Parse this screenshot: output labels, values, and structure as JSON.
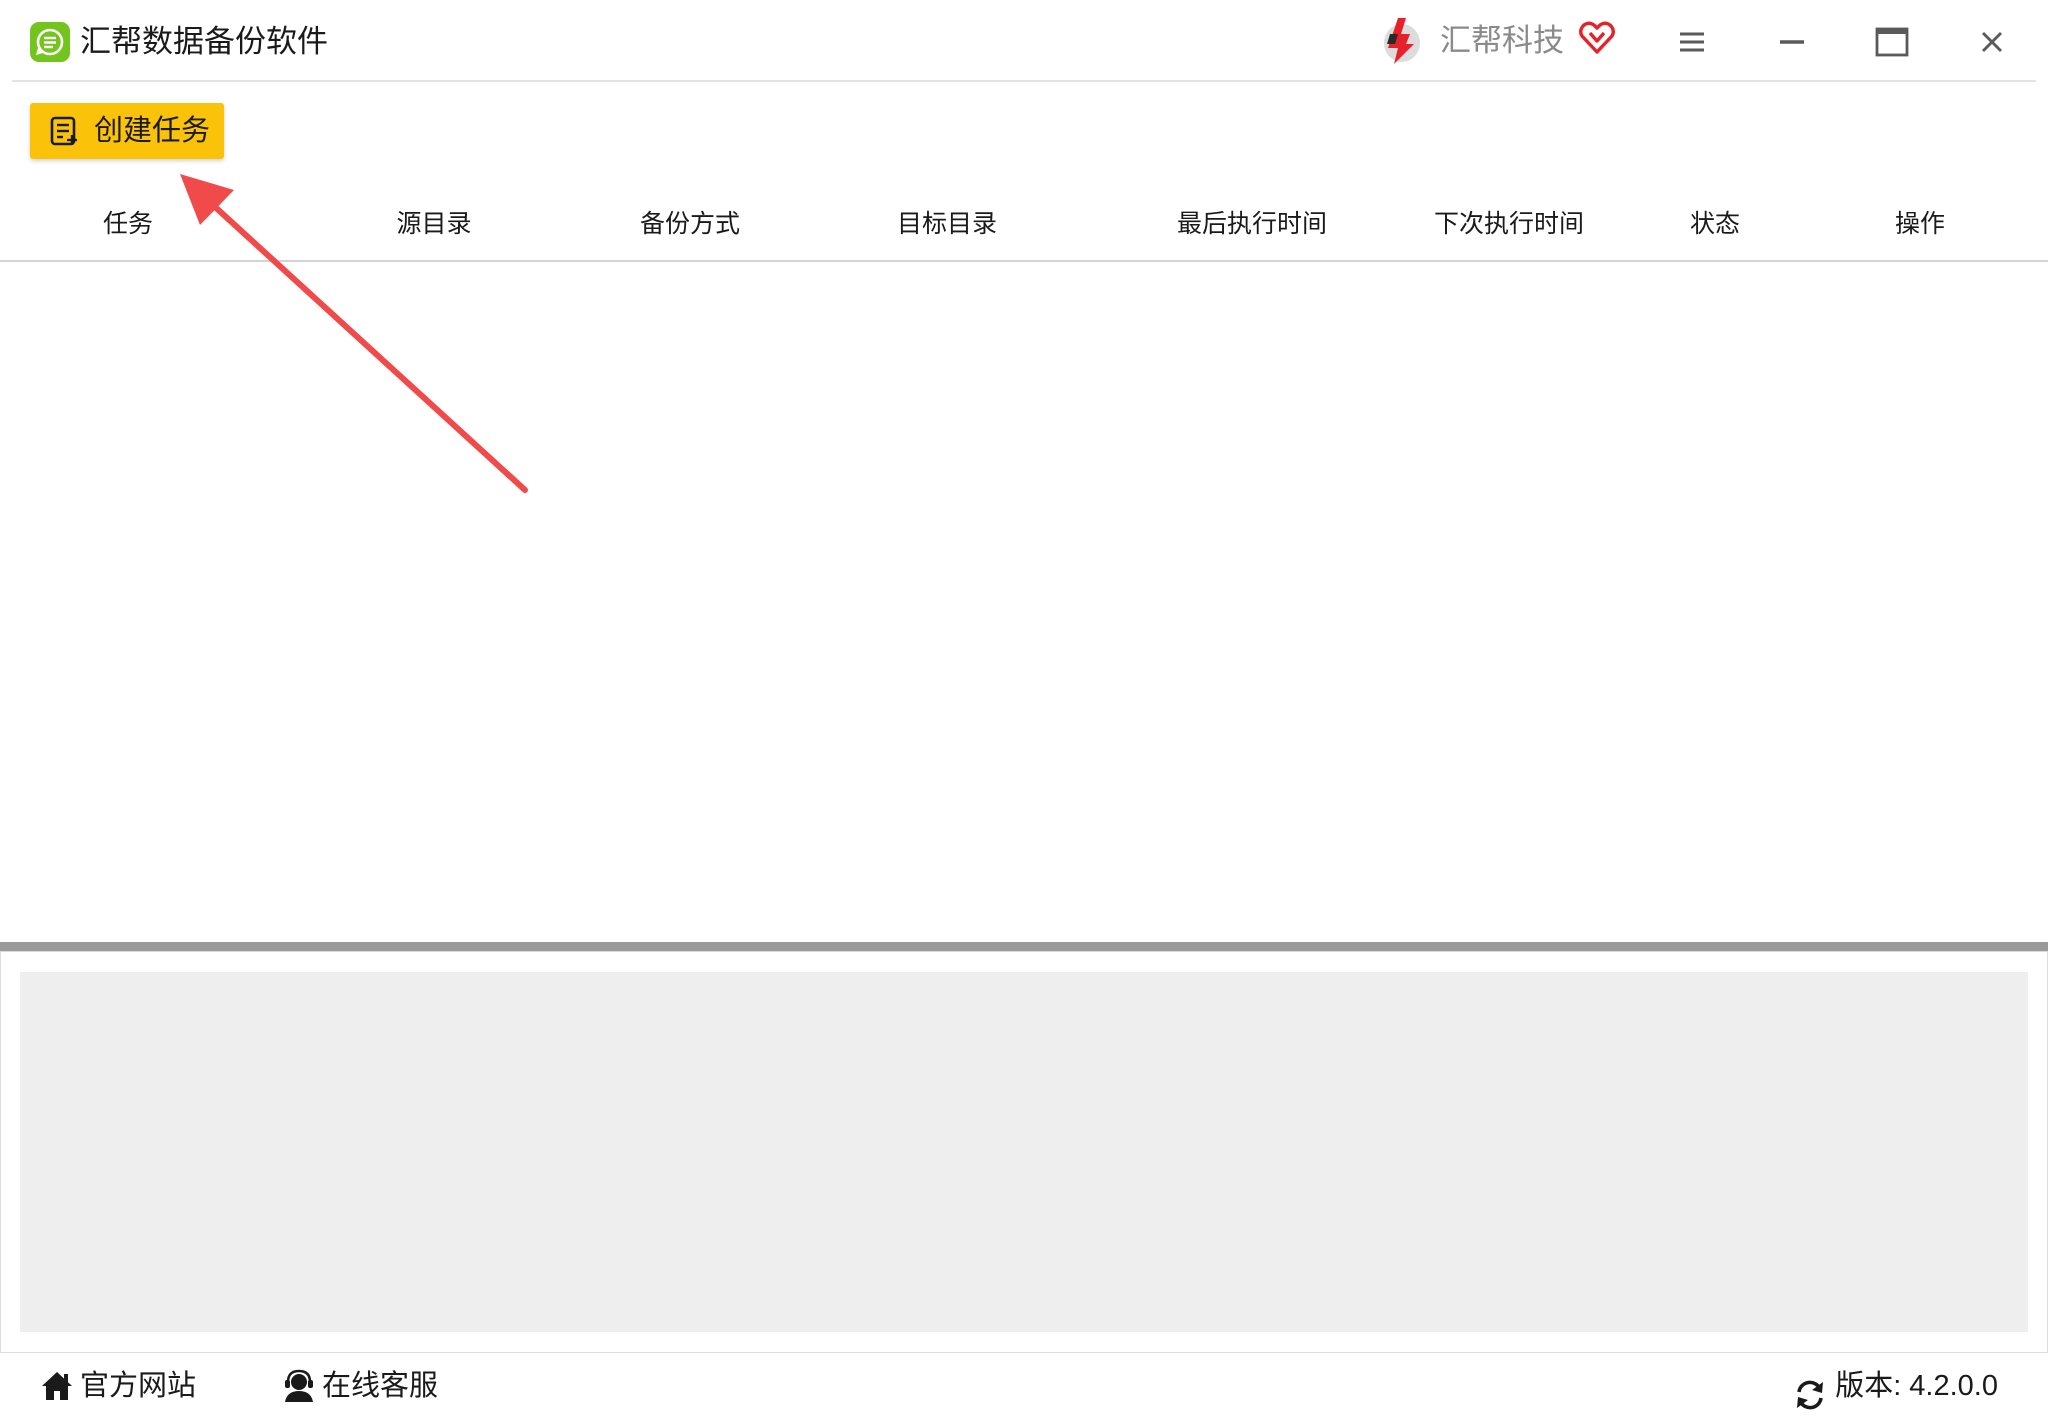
{
  "window": {
    "title": "汇帮数据备份软件",
    "brand_name": "汇帮科技"
  },
  "toolbar": {
    "create_task_label": "创建任务"
  },
  "table": {
    "columns": [
      "任务",
      "源目录",
      "备份方式",
      "目标目录",
      "最后执行时间",
      "下次执行时间",
      "状态",
      "操作"
    ],
    "rows": []
  },
  "statusbar": {
    "website_label": "官方网站",
    "support_label": "在线客服",
    "version_label": "版本:  4.2.0.0"
  },
  "icons": {
    "app": "backup-app-icon",
    "brand": "brand-logo-icon",
    "vip": "vip-heart-icon",
    "menu": "menu-icon",
    "minimize": "minimize-icon",
    "maximize": "maximize-icon",
    "close": "close-icon",
    "create_task": "task-list-icon",
    "website": "home-icon",
    "support": "support-agent-icon",
    "update": "refresh-icon"
  },
  "colors": {
    "accent": "#fbc20a",
    "app_icon": "#74c41e",
    "vip": "#e8202a",
    "annotation_arrow": "#f04a4a",
    "log_background": "#eeeeee",
    "splitter": "#9a9a9a"
  }
}
